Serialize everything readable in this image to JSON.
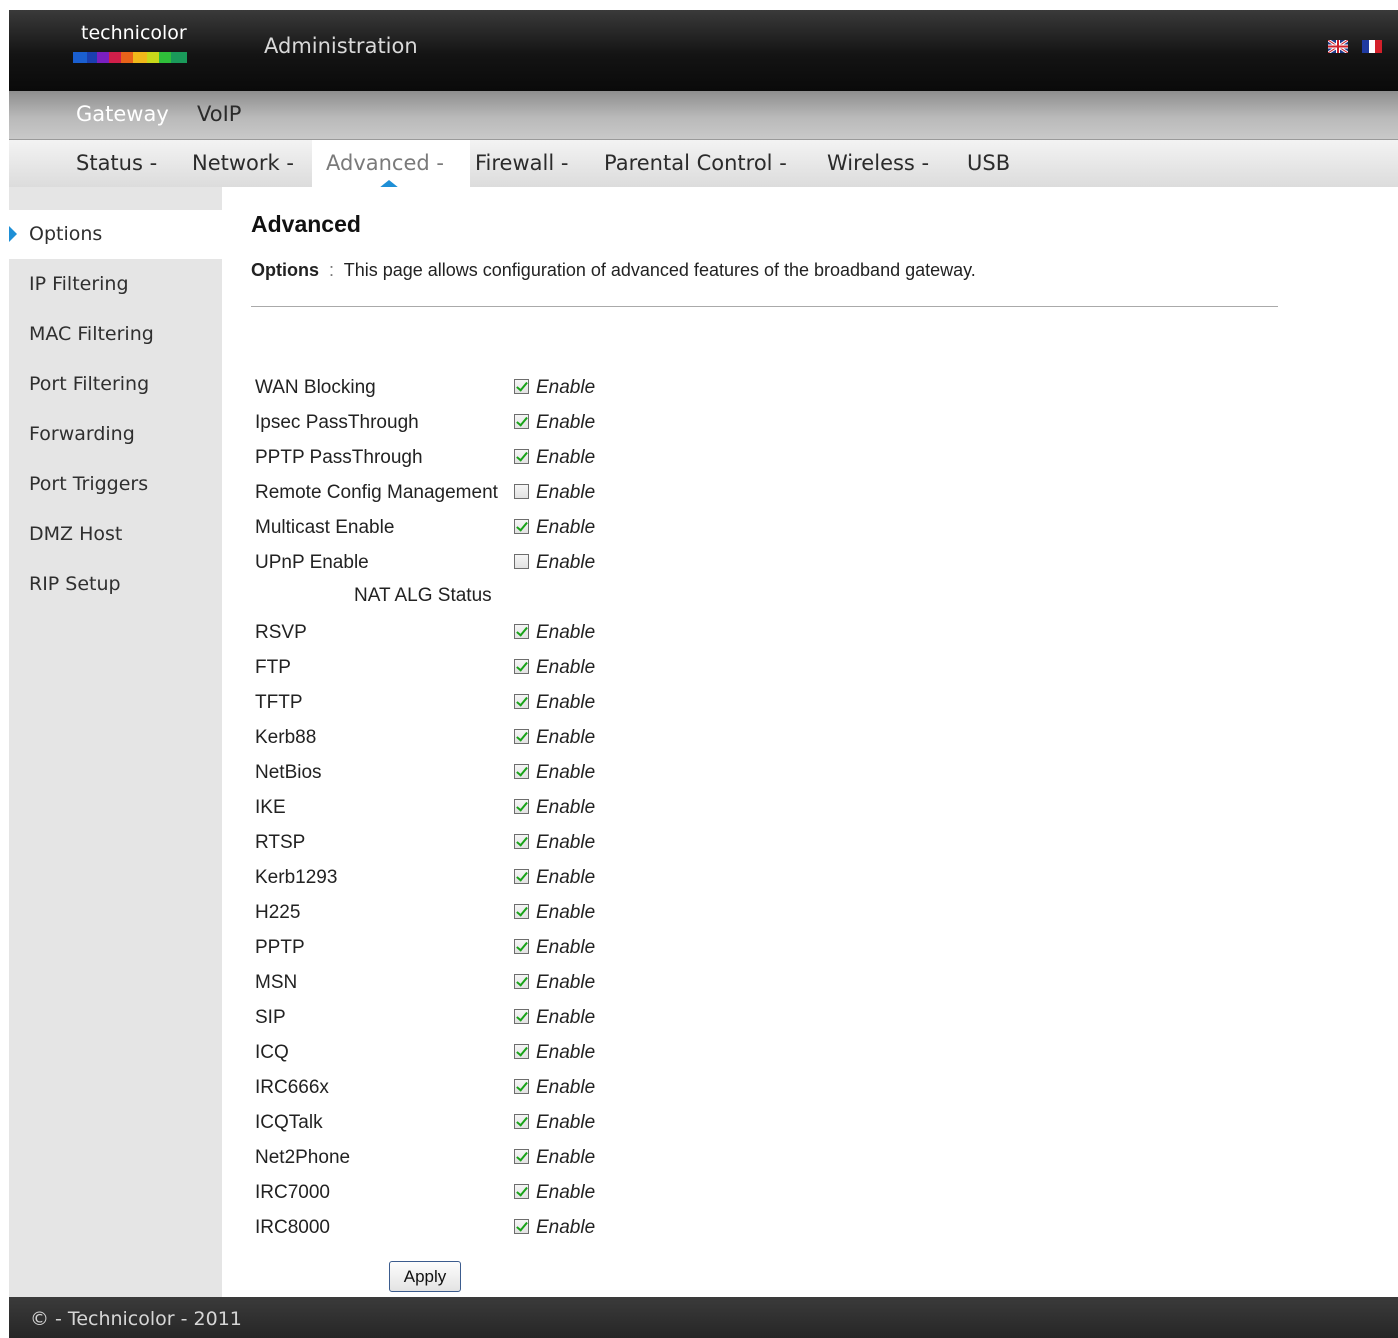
{
  "header": {
    "brand": "technicolor",
    "title": "Administration",
    "flags": [
      "uk-flag-icon",
      "fr-flag-icon"
    ]
  },
  "top_nav": {
    "items": [
      {
        "label": "Gateway",
        "active": true
      },
      {
        "label": "VoIP",
        "active": false
      }
    ]
  },
  "sub_nav": {
    "items": [
      {
        "label": "Status -"
      },
      {
        "label": "Network -"
      },
      {
        "label": "Advanced -",
        "active": true
      },
      {
        "label": "Firewall -"
      },
      {
        "label": "Parental Control -"
      },
      {
        "label": "Wireless -"
      },
      {
        "label": "USB"
      }
    ]
  },
  "sidebar": {
    "items": [
      {
        "label": "Options",
        "active": true
      },
      {
        "label": "IP Filtering"
      },
      {
        "label": "MAC Filtering"
      },
      {
        "label": "Port Filtering"
      },
      {
        "label": "Forwarding"
      },
      {
        "label": "Port Triggers"
      },
      {
        "label": "DMZ Host"
      },
      {
        "label": "RIP Setup"
      }
    ]
  },
  "main": {
    "title": "Advanced",
    "desc_label": "Options",
    "desc_sep": ":",
    "desc_text": "This page allows configuration of advanced features of the broadband gateway.",
    "enable_label": "Enable",
    "options": [
      {
        "label": "WAN Blocking",
        "checked": true
      },
      {
        "label": "Ipsec PassThrough",
        "checked": true
      },
      {
        "label": "PPTP PassThrough",
        "checked": true
      },
      {
        "label": "Remote Config Management",
        "checked": false
      },
      {
        "label": "Multicast Enable",
        "checked": true
      },
      {
        "label": "UPnP Enable",
        "checked": false
      }
    ],
    "nat_heading": "NAT ALG Status",
    "nat": [
      {
        "label": "RSVP",
        "checked": true
      },
      {
        "label": "FTP",
        "checked": true
      },
      {
        "label": "TFTP",
        "checked": true
      },
      {
        "label": "Kerb88",
        "checked": true
      },
      {
        "label": "NetBios",
        "checked": true
      },
      {
        "label": "IKE",
        "checked": true
      },
      {
        "label": "RTSP",
        "checked": true
      },
      {
        "label": "Kerb1293",
        "checked": true
      },
      {
        "label": "H225",
        "checked": true
      },
      {
        "label": "PPTP",
        "checked": true
      },
      {
        "label": "MSN",
        "checked": true
      },
      {
        "label": "SIP",
        "checked": true
      },
      {
        "label": "ICQ",
        "checked": true
      },
      {
        "label": "IRC666x",
        "checked": true
      },
      {
        "label": "ICQTalk",
        "checked": true
      },
      {
        "label": "Net2Phone",
        "checked": true
      },
      {
        "label": "IRC7000",
        "checked": true
      },
      {
        "label": "IRC8000",
        "checked": true
      }
    ],
    "apply_label": "Apply"
  },
  "footer": {
    "text": "© - Technicolor - 2011"
  },
  "colors": {
    "accent": "#1e8fd6",
    "header_bg": "#141414",
    "sidebar_bg": "#e5e5e5",
    "check": "#19a319"
  }
}
